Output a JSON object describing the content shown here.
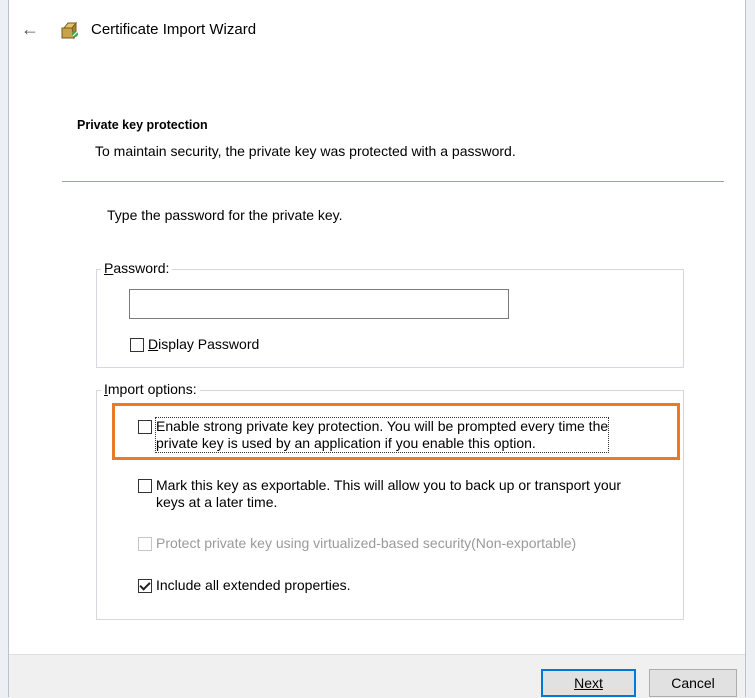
{
  "window": {
    "title": "Certificate Import Wizard"
  },
  "icons": {
    "back": "back-arrow-icon",
    "app": "certificate-wizard-icon"
  },
  "section": {
    "heading": "Private key protection",
    "description": "To maintain security, the private key was protected with a password."
  },
  "instruction": "Type the password for the private key.",
  "password_group": {
    "legend": "Password:",
    "value": "",
    "display_password_label": "Display Password",
    "display_password_checked": false
  },
  "import_options": {
    "legend": "Import options:",
    "strong_protection": {
      "line1": "Enable strong private key protection. You will be prompted every time the",
      "line2": "private key is used by an application if you enable this option.",
      "checked": false
    },
    "exportable": {
      "line1": "Mark this key as exportable. This will allow you to back up or transport your",
      "line2": "keys at a later time.",
      "checked": false
    },
    "vbs": {
      "label": "Protect private key using virtualized-based security(Non-exportable)",
      "checked": false,
      "disabled": true
    },
    "extended": {
      "label": "Include all extended properties.",
      "checked": true
    }
  },
  "highlight_color": "#ec7a25",
  "buttons": {
    "next": "Next",
    "cancel": "Cancel"
  }
}
